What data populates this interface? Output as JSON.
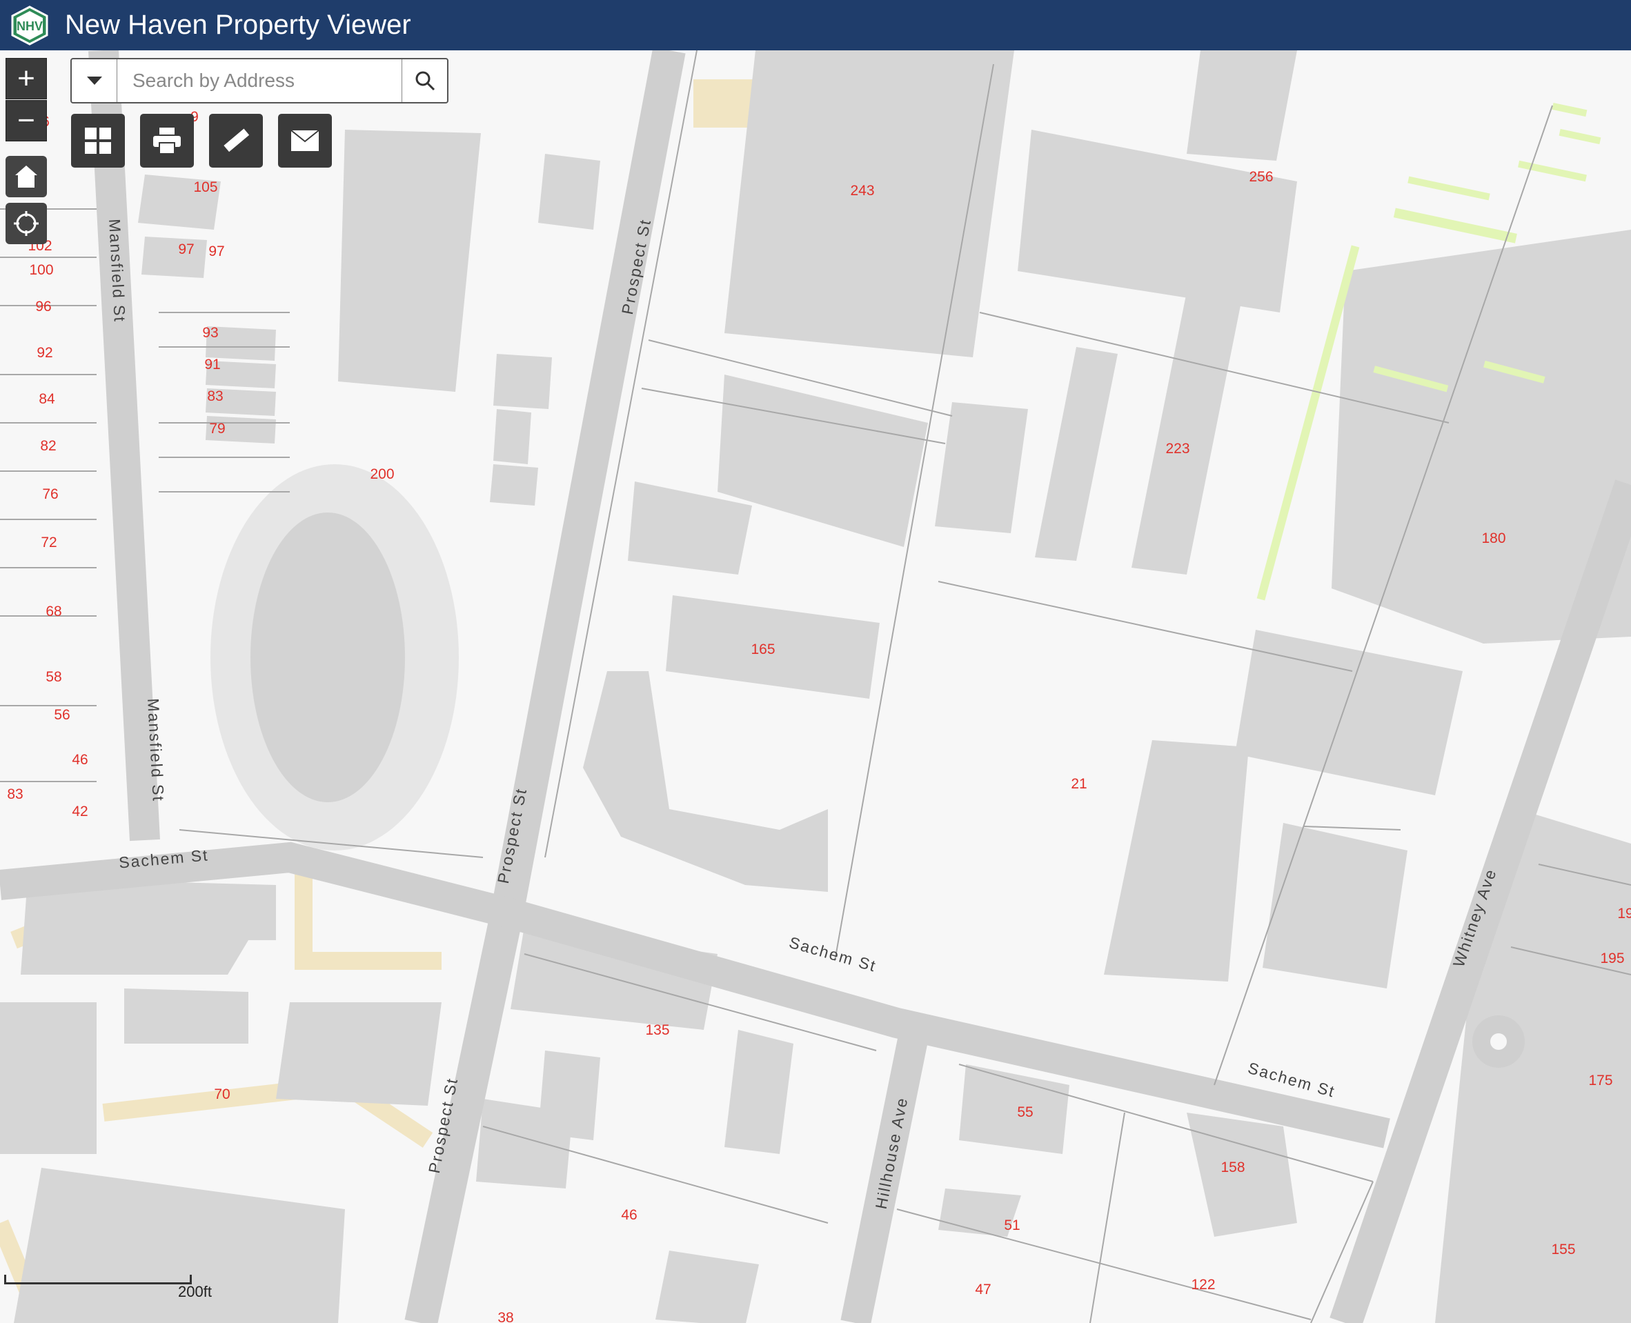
{
  "header": {
    "title": "New Haven Property Viewer",
    "logo_text": "NHV"
  },
  "search": {
    "placeholder": "Search by Address"
  },
  "controls": {
    "zoom_in": "+",
    "zoom_out": "−",
    "icons": [
      "home-icon",
      "locate-icon",
      "basemap-gallery-icon",
      "print-icon",
      "measure-icon",
      "share-icon"
    ]
  },
  "scale": {
    "label": "200ft"
  },
  "streets": {
    "mansfield_1": "Mansfield St",
    "mansfield_2": "Mansfield St",
    "prospect_1": "Prospect St",
    "prospect_2": "Prospect St",
    "prospect_3": "Prospect St",
    "sachem_1": "Sachem St",
    "sachem_2": "Sachem St",
    "sachem_3": "Sachem St",
    "hillhouse": "Hillhouse Ave",
    "whitney": "Whitney Ave"
  },
  "parcel_labels": [
    "105",
    "97",
    "97",
    "102",
    "100",
    "96",
    "93",
    "92",
    "91",
    "84",
    "83",
    "79",
    "82",
    "76",
    "72",
    "68",
    "58",
    "56",
    "46",
    "83",
    "42",
    "200",
    "243",
    "256",
    "223",
    "180",
    "165",
    "21",
    "135",
    "70",
    "55",
    "158",
    "51",
    "46",
    "47",
    "122",
    "175",
    "155",
    "195",
    "38",
    "19",
    "6",
    "9"
  ],
  "colors": {
    "header": "#1f3d6b",
    "road": "#cfcfcf",
    "building": "#d6d6d6",
    "parcel_label": "#e0312b",
    "green": "#e2f5b5",
    "path": "#f2e6c4"
  }
}
